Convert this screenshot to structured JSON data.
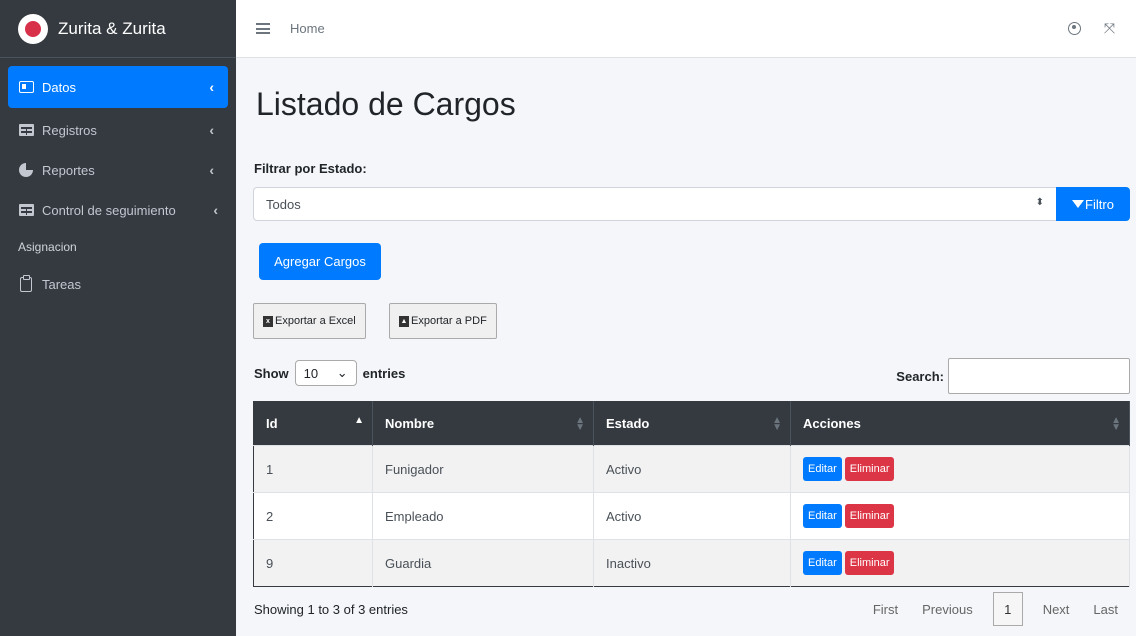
{
  "brand": {
    "name": "Zurita & Zurita"
  },
  "sidebar": {
    "items": [
      {
        "label": "Datos",
        "icon": "id-card-icon"
      },
      {
        "label": "Registros",
        "icon": "table-icon"
      },
      {
        "label": "Reportes",
        "icon": "pie-chart-icon"
      },
      {
        "label": "Control de seguimiento",
        "icon": "table-icon"
      }
    ],
    "header": "Asignacion",
    "tareas": {
      "label": "Tareas",
      "icon": "clipboard-icon"
    }
  },
  "topbar": {
    "home": "Home"
  },
  "main": {
    "title": "Listado de Cargos",
    "filter_label": "Filtrar por Estado:",
    "filter_value": "Todos",
    "filter_button": "Filtro",
    "add_button": "Agregar Cargos",
    "export_excel": "Exportar a Excel",
    "export_pdf": "Exportar a PDF",
    "show": "Show",
    "entries_value": "10",
    "entries": "entries",
    "search_label": "Search:"
  },
  "table": {
    "headers": [
      "Id",
      "Nombre",
      "Estado",
      "Acciones"
    ],
    "rows": [
      {
        "id": "1",
        "nombre": "Funigador",
        "estado": "Activo"
      },
      {
        "id": "2",
        "nombre": "Empleado",
        "estado": "Activo"
      },
      {
        "id": "9",
        "nombre": "Guardia",
        "estado": "Inactivo"
      }
    ],
    "edit_label": "Editar",
    "delete_label": "Eliminar"
  },
  "footer": {
    "info": "Showing 1 to 3 of 3 entries",
    "first": "First",
    "previous": "Previous",
    "current": "1",
    "next": "Next",
    "last": "Last"
  },
  "colors": {
    "primary": "#007bff",
    "danger": "#dc3545",
    "success": "#28a745",
    "sidebar": "#343a40"
  }
}
